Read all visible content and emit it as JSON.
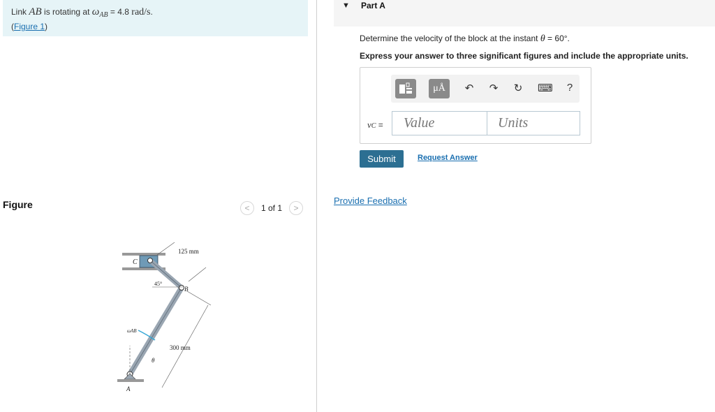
{
  "problem": {
    "prefix": "Link",
    "link_var": "AB",
    "mid_text": "is rotating at",
    "omega": "ω",
    "omega_sub": "AB",
    "equals_value": "= 4.8",
    "unit": "rad/s",
    "period": ".",
    "figure_link_open": "(",
    "figure_link": "Figure 1",
    "figure_link_close": ")"
  },
  "figure": {
    "label": "Figure",
    "pager_prev": "<",
    "pager_count": "1 of 1",
    "pager_next": ">",
    "labels": {
      "c": "C",
      "b": "B",
      "a": "A",
      "angle45": "45°",
      "len125": "125 mm",
      "len300": "300 mm",
      "omega": "ωAB",
      "theta": "θ"
    }
  },
  "part": {
    "title": "Part A",
    "question_prefix": "Determine the velocity of the block at the instant",
    "question_var": "θ",
    "question_value": "= 60°",
    "question_end": ".",
    "instruction": "Express your answer to three significant figures and include the appropriate units.",
    "toolbar": {
      "units_label": "μÅ",
      "undo": "↶",
      "redo": "↷",
      "reset": "↻",
      "keyboard": "⌨",
      "help": "?"
    },
    "var_label": "v",
    "var_sub": "C",
    "var_eq": "=",
    "value_placeholder": "Value",
    "units_placeholder": "Units",
    "submit_label": "Submit",
    "request_label": "Request Answer"
  },
  "feedback_label": "Provide Feedback",
  "colors": {
    "accent": "#2c6f92",
    "link": "#1a6fb0",
    "problem_bg": "#e6f4f7"
  }
}
